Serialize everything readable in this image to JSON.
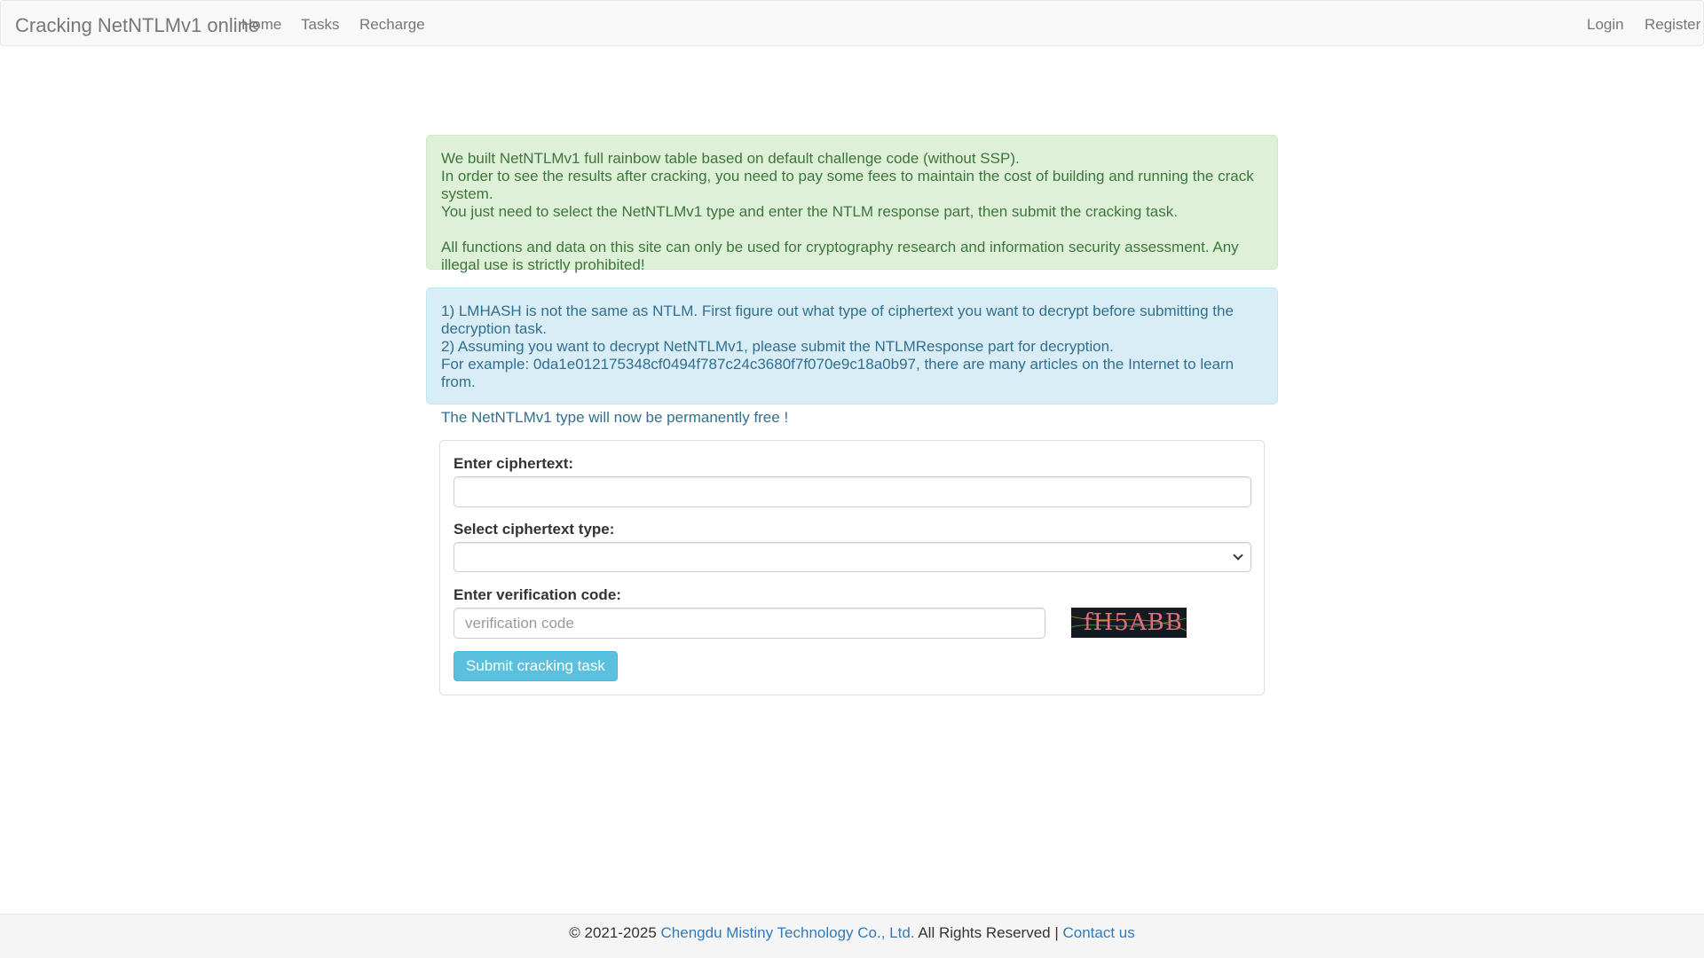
{
  "navbar": {
    "brand": "Cracking NetNTLMv1 online",
    "links": [
      "Home",
      "Tasks",
      "Recharge"
    ],
    "right_links": [
      "Login",
      "Register"
    ]
  },
  "alert_success": {
    "lines": [
      "We built NetNTLMv1 full rainbow table based on default challenge code (without SSP).",
      "In order to see the results after cracking, you need to pay some fees to maintain the cost of building and running the crack system.",
      "You just need to select the NetNTLMv1 type and enter the NTLM response part, then submit the cracking task.",
      "All functions and data on this site can only be used for cryptography research and information security assessment. Any illegal use is strictly prohibited!"
    ]
  },
  "alert_info": {
    "lines": [
      "1) LMHASH is not the same as NTLM. First figure out what type of ciphertext you want to decrypt before submitting the decryption task.",
      "2) Assuming you want to decrypt NetNTLMv1, please submit the NTLMResponse part for decryption.",
      "For example: 0da1e012175348cf0494f787c24c3680f7f070e9c18a0b97, there are many articles on the Internet to learn from.",
      "The NetNTLMv1 type will now be permanently free !"
    ]
  },
  "form": {
    "ciphertext_label": "Enter ciphertext:",
    "ciphertext_value": "",
    "type_label": "Select ciphertext type:",
    "type_selected": "",
    "verification_label": "Enter verification code:",
    "verification_placeholder": "verification code",
    "captcha_text": "fH5ABB",
    "submit_label": "Submit cracking task"
  },
  "footer": {
    "copyright": "© 2021-2025",
    "company": "Chengdu Mistiny Technology Co., Ltd.",
    "rights": "All Rights Reserved |",
    "contact": "Contact us"
  }
}
